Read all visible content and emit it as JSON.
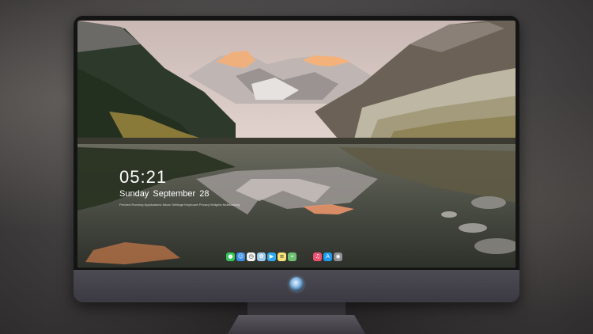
{
  "lockscreen": {
    "time": "05:21",
    "date": "Sunday September  28",
    "hint": "Preview·Running·Applications·Music·Settings·Keyboard·Privacy·Widgets·Multitasking"
  },
  "dock": {
    "apps": [
      {
        "name": "Messages",
        "icon": "message-icon",
        "color": "#34c759",
        "glyph": "●"
      },
      {
        "name": "Finder",
        "icon": "finder-icon",
        "color": "#3a8ee6",
        "glyph": "☺"
      },
      {
        "name": "Clock",
        "icon": "clock-icon",
        "color": "#f2f2f2",
        "glyph": "◷"
      },
      {
        "name": "Photos",
        "icon": "photos-icon",
        "color": "#9ec9e8",
        "glyph": "✿"
      },
      {
        "name": "Clips",
        "icon": "clips-icon",
        "color": "#2fa8f0",
        "glyph": "▶"
      },
      {
        "name": "Notes",
        "icon": "notes-icon",
        "color": "#f7e27a",
        "glyph": "≡"
      },
      {
        "name": "Maps",
        "icon": "maps-icon",
        "color": "#6fbf73",
        "glyph": "⌖"
      },
      {
        "name": "Music",
        "icon": "music-icon",
        "color": "#f2506e",
        "glyph": "♫"
      },
      {
        "name": "App Store",
        "icon": "app-store-icon",
        "color": "#1d9bf0",
        "glyph": "A"
      },
      {
        "name": "Camera",
        "icon": "camera-icon",
        "color": "#8e8e93",
        "glyph": "◉"
      }
    ]
  }
}
